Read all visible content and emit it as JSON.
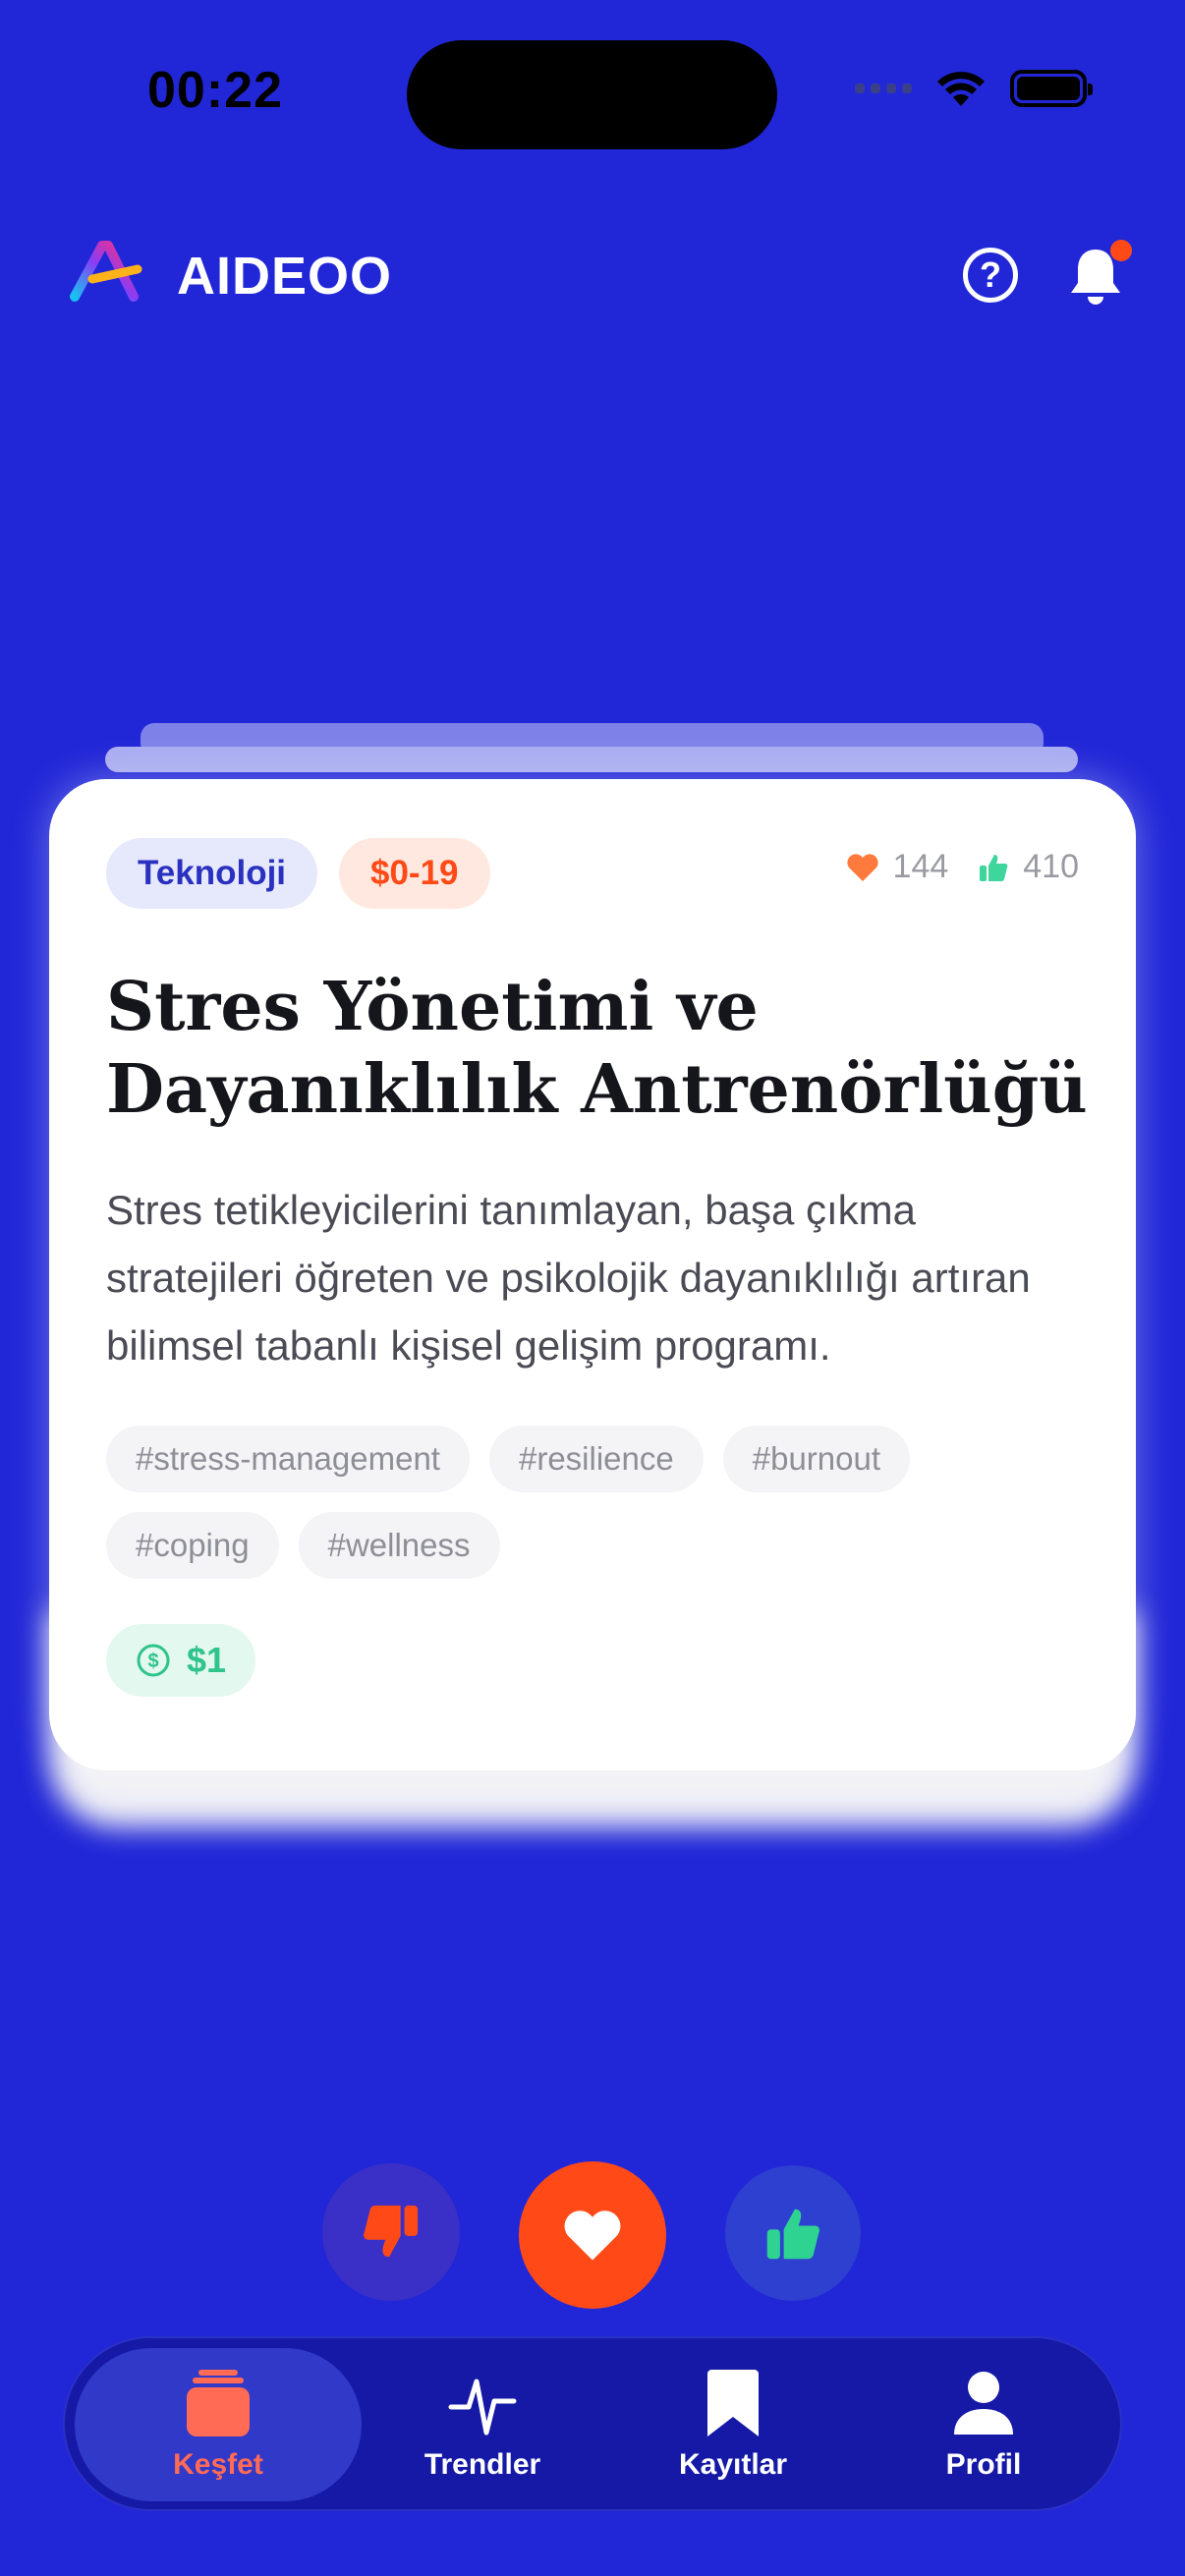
{
  "status": {
    "time": "00:22"
  },
  "header": {
    "app_name": "AIDEOO",
    "help_glyph": "?"
  },
  "card": {
    "category": "Teknoloji",
    "price_range": "$0-19",
    "hearts": "144",
    "likes": "410",
    "title": "Stres Yönetimi ve Dayanıklılık Antrenörlüğü",
    "description": "Stres tetikleyicilerini tanımlayan, başa çıkma stratejileri öğreten ve psikolojik dayanıklılığı artıran bilimsel tabanlı kişisel gelişim programı.",
    "tags": [
      "#stress-management",
      "#resilience",
      "#burnout",
      "#coping",
      "#wellness"
    ],
    "cost": "$1"
  },
  "tabs": [
    {
      "label": "Keşfet",
      "icon": "cards-icon",
      "active": true
    },
    {
      "label": "Trendler",
      "icon": "pulse-icon",
      "active": false
    },
    {
      "label": "Kayıtlar",
      "icon": "bookmark-icon",
      "active": false
    },
    {
      "label": "Profil",
      "icon": "person-icon",
      "active": false
    }
  ],
  "colors": {
    "background": "#2127d7",
    "accent": "#ff4a17",
    "success": "#2fc48b",
    "tab_bar": "#1519a6"
  }
}
